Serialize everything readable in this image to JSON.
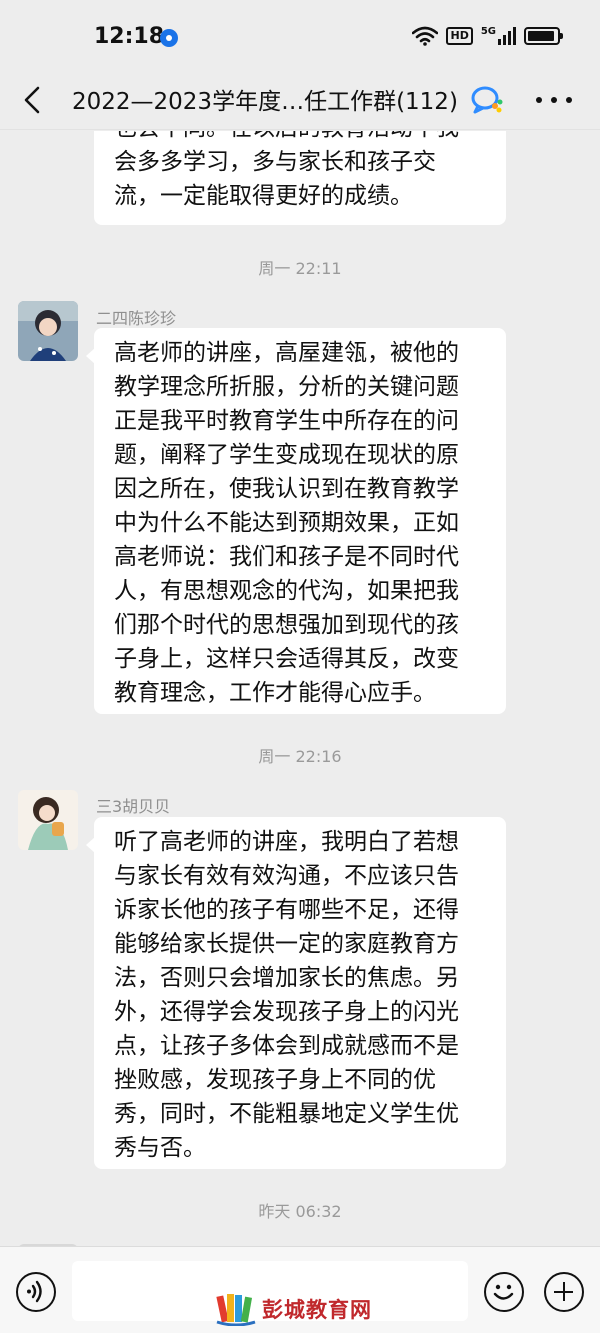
{
  "status_bar": {
    "time": "12:18",
    "hd_label": "HD",
    "network_label": "5G"
  },
  "nav": {
    "title": "2022—2023学年度…任工作群(112)"
  },
  "messages": [
    {
      "type": "text_cut",
      "lines": [
        "也会不同。在以后的教育活动中我",
        "会多多学习，多与家长和孩子交",
        "流，一定能取得更好的成绩。"
      ]
    },
    {
      "type": "time",
      "text": "周一 22:11"
    },
    {
      "type": "text",
      "sender": "二四陈珍珍",
      "lines": [
        "高老师的讲座，高屋建瓴，被他的",
        "教学理念所折服，分析的关键问题",
        "正是我平时教育学生中所存在的问",
        "题，阐释了学生变成现在现状的原",
        "因之所在，使我认识到在教育教学",
        "中为什么不能达到预期效果，正如",
        "高老师说：我们和孩子是不同时代",
        "人，有思想观念的代沟，如果把我",
        "们那个时代的思想强加到现代的孩",
        "子身上，这样只会适得其反，改变",
        "教育理念，工作才能得心应手。"
      ]
    },
    {
      "type": "time",
      "text": "周一 22:16"
    },
    {
      "type": "text",
      "sender": "三3胡贝贝",
      "lines": [
        "听了高老师的讲座，我明白了若想",
        "与家长有效有效沟通，不应该只告",
        "诉家长他的孩子有哪些不足，还得",
        "能够给家长提供一定的家庭教育方",
        "法，否则只会增加家长的焦虑。另",
        "外，还得学会发现孩子身上的闪光",
        "点，让孩子多体会到成就感而不是",
        "挫败感，发现孩子身上不同的优",
        "秀，同时，不能粗暴地定义学生优",
        "秀与否。"
      ]
    },
    {
      "type": "time",
      "text": "昨天 06:32"
    }
  ],
  "watermark": {
    "text": "彭城教育网"
  }
}
